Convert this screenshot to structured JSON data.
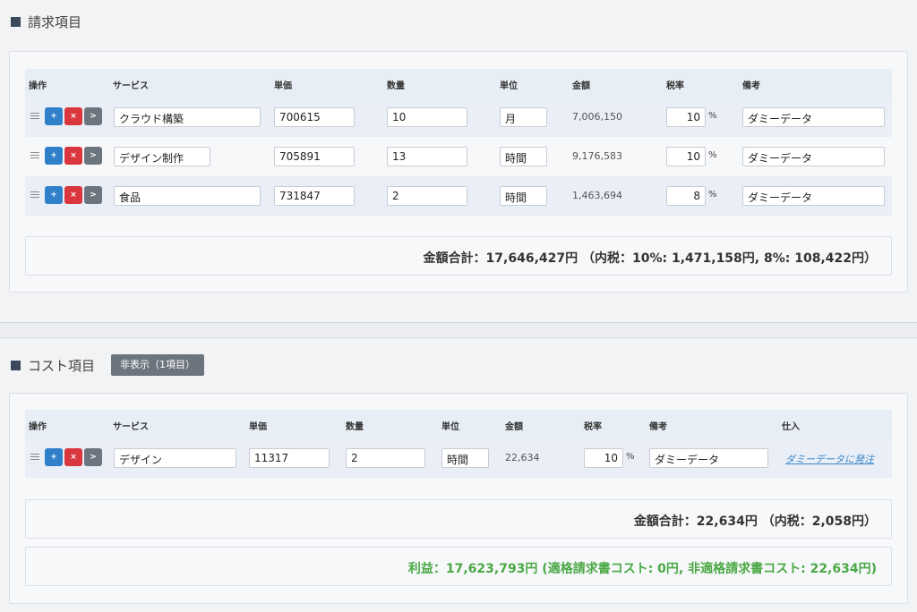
{
  "billing": {
    "title": "請求項目",
    "headers": [
      "操作",
      "サービス",
      "単価",
      "数量",
      "単位",
      "金額",
      "税率",
      "備考"
    ],
    "rows": [
      {
        "service": "クラウド構築",
        "unit_price": "700615",
        "qty": "10",
        "unit": "月",
        "amount": "7,006,150",
        "tax": "10",
        "note": "ダミーデータ"
      },
      {
        "service": "デザイン制作",
        "unit_price": "705891",
        "qty": "13",
        "unit": "時間",
        "amount": "9,176,583",
        "tax": "10",
        "note": "ダミーデータ"
      },
      {
        "service": "食品",
        "unit_price": "731847",
        "qty": "2",
        "unit": "時間",
        "amount": "1,463,694",
        "tax": "8",
        "note": "ダミーデータ"
      }
    ],
    "total": "金額合計：17,646,427円 （内税：10%: 1,471,158円, 8%: 108,422円）"
  },
  "cost": {
    "title": "コスト項目",
    "hide_label": "非表示（1項目）",
    "headers": [
      "操作",
      "サービス",
      "単価",
      "数量",
      "単位",
      "金額",
      "税率",
      "備考",
      "仕入"
    ],
    "rows": [
      {
        "service": "デザイン",
        "unit_price": "11317",
        "qty": "2",
        "unit": "時間",
        "amount": "22,634",
        "tax": "10",
        "note": "ダミーデータ",
        "order_link": "ダミーデータに発注"
      }
    ],
    "total": "金額合計：22,634円 （内税：2,058円）",
    "profit": "利益：17,623,793円 (適格請求書コスト: 0円, 非適格請求書コスト: 22,634円)"
  },
  "common": {
    "plus": "+",
    "remove": "×",
    "go": ">",
    "percent": "%"
  },
  "colors": {
    "plus_button": "#2f80c8",
    "remove_button": "#d9363e",
    "go_button": "#6c757d",
    "profit_text": "#4aa845",
    "link": "#3b88c8"
  }
}
